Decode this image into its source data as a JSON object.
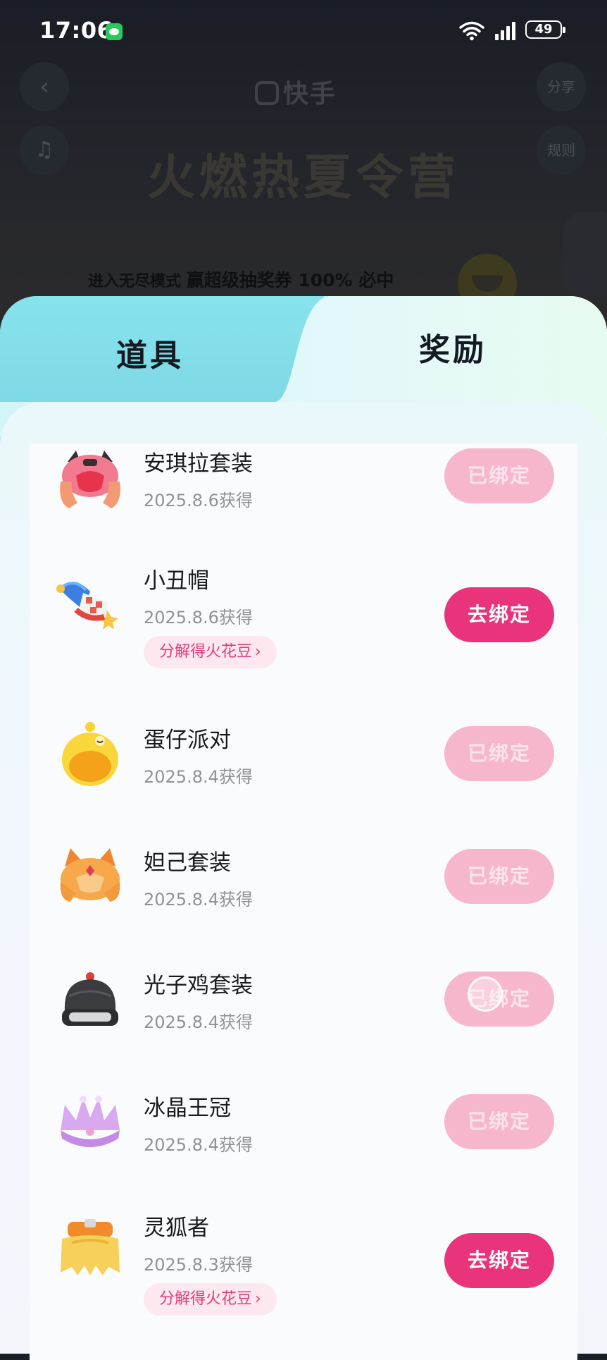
{
  "status_bar": {
    "time": "17:06",
    "battery": "49"
  },
  "background": {
    "logo": "快手",
    "share": "分享",
    "rules": "规则",
    "title": "火燃热夏令营",
    "banner_prefix": "进入无尽模式",
    "banner_highlight": "赢超级抽奖券 100% 必中"
  },
  "tabs": [
    {
      "label": "道具",
      "active": false
    },
    {
      "label": "奖励",
      "active": true
    }
  ],
  "rewards": [
    {
      "name": "安琪拉套装",
      "date": "2025.8.6获得",
      "button": "已绑定",
      "state": "bound",
      "icon": "angela-hair-icon"
    },
    {
      "name": "小丑帽",
      "date": "2025.8.6获得",
      "button": "去绑定",
      "state": "unbound",
      "chip": "分解得火花豆",
      "icon": "clown-hat-icon"
    },
    {
      "name": "蛋仔派对",
      "date": "2025.8.4获得",
      "button": "已绑定",
      "state": "bound",
      "icon": "eggy-icon"
    },
    {
      "name": "妲己套装",
      "date": "2025.8.4获得",
      "button": "已绑定",
      "state": "bound",
      "icon": "daji-hair-icon"
    },
    {
      "name": "光子鸡套装",
      "date": "2025.8.4获得",
      "button": "已绑定",
      "state": "bound",
      "icon": "helmet-icon"
    },
    {
      "name": "冰晶王冠",
      "date": "2025.8.4获得",
      "button": "已绑定",
      "state": "bound",
      "icon": "crown-icon"
    },
    {
      "name": "灵狐者",
      "date": "2025.8.3获得",
      "button": "去绑定",
      "state": "unbound",
      "chip": "分解得火花豆",
      "icon": "fox-hair-icon"
    }
  ],
  "colors": {
    "accent": "#e9337a",
    "bound_button": "#f6b7cd",
    "chip_bg": "#fde8ef",
    "sheet_gradient_start": "#8fe7ea"
  }
}
